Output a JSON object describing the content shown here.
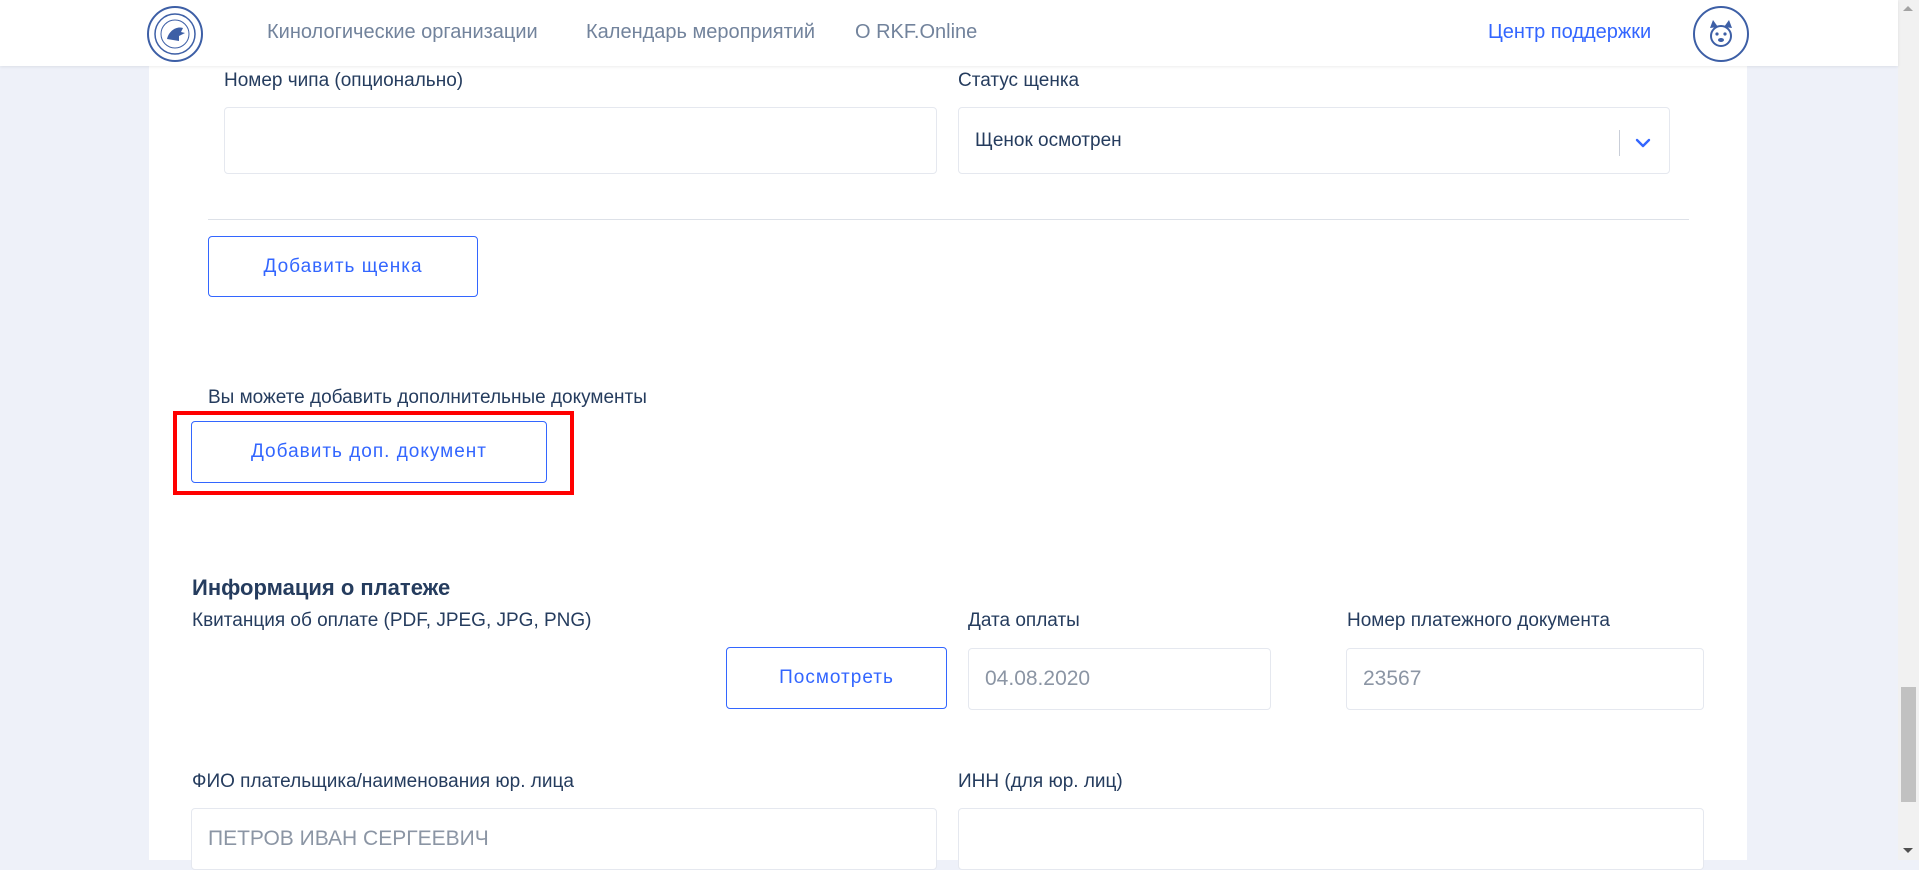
{
  "header": {
    "nav": [
      {
        "label": "Кинологические организации"
      },
      {
        "label": "Календарь мероприятий"
      },
      {
        "label": "О RKF.Online"
      }
    ],
    "support_label": "Центр поддержки"
  },
  "puppy": {
    "chip_label": "Номер чипа (опционально)",
    "chip_value": "",
    "status_label": "Статус щенка",
    "status_value": "Щенок осмотрен",
    "add_puppy_button": "Добавить щенка"
  },
  "extra_docs": {
    "hint": "Вы можете добавить дополнительные документы",
    "add_button": "Добавить доп. документ"
  },
  "payment": {
    "title": "Информация о платеже",
    "receipt_label": "Квитанция об оплате (PDF, JPEG, JPG, PNG)",
    "view_button": "Посмотреть",
    "date_label": "Дата оплаты",
    "date_value": "04.08.2020",
    "doc_number_label": "Номер платежного документа",
    "doc_number_value": "23567",
    "payer_label": "ФИО плательщика/наименования юр. лица",
    "payer_value": "ПЕТРОВ ИВАН СЕРГЕЕВИЧ",
    "inn_label": "ИНН (для юр. лиц)",
    "inn_value": ""
  },
  "colors": {
    "accent": "#3366ff",
    "text": "#253c5e",
    "highlight": "#ff0000",
    "background": "#eef1f9"
  }
}
